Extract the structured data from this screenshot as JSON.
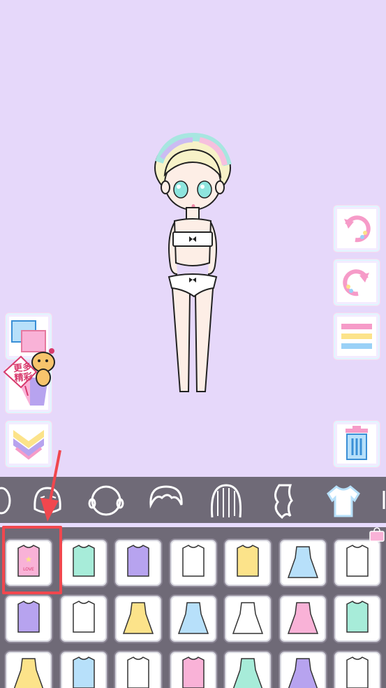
{
  "promo": {
    "line1": "更多",
    "line2": "精彩"
  },
  "categories": [
    {
      "name": "eyes"
    },
    {
      "name": "face"
    },
    {
      "name": "head"
    },
    {
      "name": "hair-front"
    },
    {
      "name": "hair-back"
    },
    {
      "name": "hair-side"
    },
    {
      "name": "tops"
    }
  ],
  "selected_category": "tops",
  "tiles_row1": [
    "love-tank-top",
    "mint-shirt",
    "rainbow-strap-top",
    "white-slip",
    "yellow-slip",
    "blue-ruffle-dress",
    "raglan-tee"
  ],
  "tiles_row2": [
    "white-blouse",
    "pink-crop",
    "yellow-sundress",
    "heart-dress",
    "blue-long-dress",
    "pink-heart-dress",
    "blue-vest"
  ],
  "tiles_row3": [
    "mint-bow-dress",
    "blue-sweater",
    "mint-tee",
    "purple-tee",
    "mint-star-dress",
    "pink-skirt",
    "blue-shirt"
  ],
  "tile_label": "LOVE",
  "colors": {
    "background": "#e6d8fa",
    "panel": "#6f6a77",
    "highlight": "#f0474e"
  }
}
